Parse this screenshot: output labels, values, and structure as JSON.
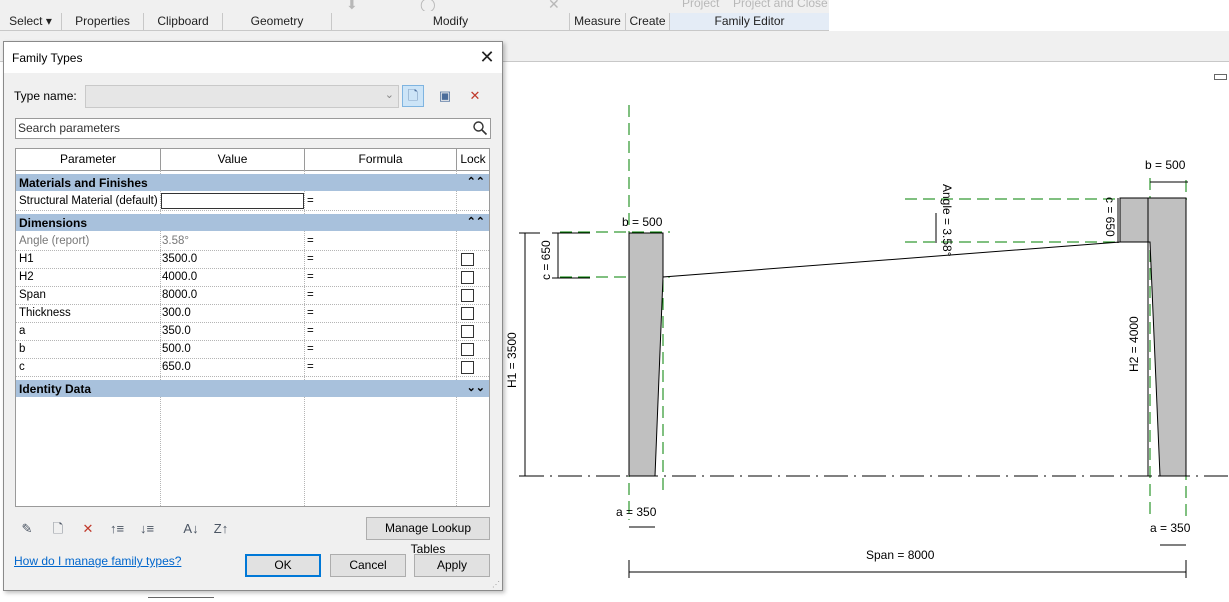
{
  "ribbon": {
    "panels": [
      {
        "name": "select",
        "label": "Select ▾"
      },
      {
        "name": "properties",
        "label": "Properties"
      },
      {
        "name": "clipboard",
        "label": "Clipboard"
      },
      {
        "name": "geometry",
        "label": "Geometry"
      },
      {
        "name": "modify",
        "label": "Modify"
      },
      {
        "name": "measure",
        "label": "Measure"
      },
      {
        "name": "create",
        "label": "Create"
      },
      {
        "name": "family-editor",
        "label": "Family Editor"
      }
    ],
    "ghost_text": [
      "Project",
      "Project and Close"
    ]
  },
  "dialog": {
    "title": "Family Types",
    "type_name_label": "Type name:",
    "type_name_value": "",
    "search_placeholder": "Search parameters",
    "columns": [
      "Parameter",
      "Value",
      "Formula",
      "Lock"
    ],
    "groups": {
      "materials": {
        "label": "Materials and Finishes",
        "chevron": "⌃⌃"
      },
      "dimensions": {
        "label": "Dimensions",
        "chevron": "⌃⌃"
      },
      "identity": {
        "label": "Identity Data",
        "chevron": "⌄⌄"
      }
    },
    "material_row": {
      "parameter": "Structural Material (default)",
      "value": "",
      "formula": "="
    },
    "dimension_rows": [
      {
        "parameter": "Angle (report)",
        "value": "3.58°",
        "formula": "=",
        "lock": null
      },
      {
        "parameter": "H1",
        "value": "3500.0",
        "formula": "=",
        "lock": false
      },
      {
        "parameter": "H2",
        "value": "4000.0",
        "formula": "=",
        "lock": false
      },
      {
        "parameter": "Span",
        "value": "8000.0",
        "formula": "=",
        "lock": false
      },
      {
        "parameter": "Thickness",
        "value": "300.0",
        "formula": "=",
        "lock": false
      },
      {
        "parameter": "a",
        "value": "350.0",
        "formula": "=",
        "lock": false
      },
      {
        "parameter": "b",
        "value": "500.0",
        "formula": "=",
        "lock": false
      },
      {
        "parameter": "c",
        "value": "650.0",
        "formula": "=",
        "lock": false
      }
    ],
    "manage_lookup_label": "Manage Lookup Tables",
    "help_link": "How do I manage family types?",
    "ok_label": "OK",
    "cancel_label": "Cancel",
    "apply_label": "Apply"
  },
  "drawing": {
    "b_left": "b = 500",
    "b_right": "b = 500",
    "c_left": "c = 650",
    "c_right": "c = 650",
    "angle": "Angle = 3.58°",
    "h1": "H1 = 3500",
    "h2": "H2 = 4000",
    "a_left": "a = 350",
    "a_right": "a = 350",
    "span": "Span = 8000"
  },
  "colors": {
    "group_header": "#a8c1dc",
    "member_fill": "#c0c0c0",
    "reference_plane": "#008000",
    "link": "#0066cc"
  }
}
